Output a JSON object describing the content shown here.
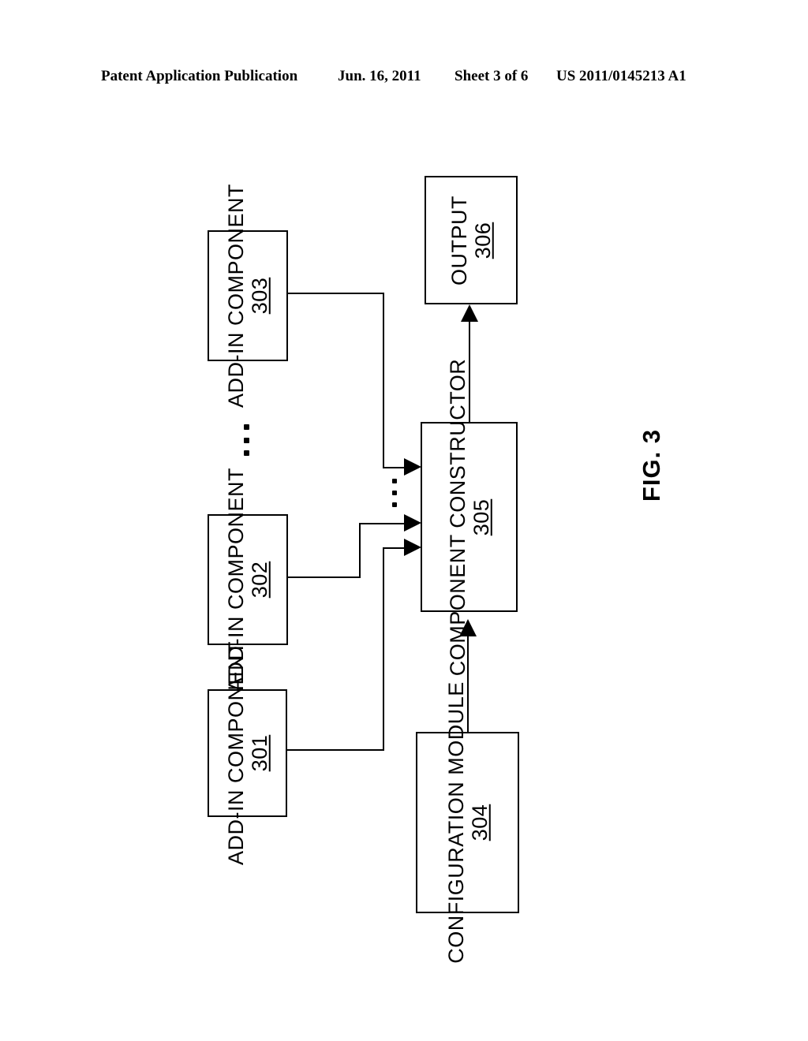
{
  "header": {
    "publication": "Patent Application Publication",
    "date": "Jun. 16, 2011",
    "sheet": "Sheet 3 of 6",
    "patent_number": "US 2011/0145213 A1"
  },
  "figure": {
    "label": "FIG. 3",
    "nodes": [
      {
        "id": "303",
        "name": "add-in-component-303",
        "line1": "ADD-IN",
        "line2": "COMPONENT",
        "ref": "303"
      },
      {
        "id": "302",
        "name": "add-in-component-302",
        "line1": "ADD-IN",
        "line2": "COMPONENT",
        "ref": "302"
      },
      {
        "id": "301",
        "name": "add-in-component-301",
        "line1": "ADD-IN",
        "line2": "COMPONENT",
        "ref": "301"
      },
      {
        "id": "306",
        "name": "output-306",
        "line1": "OUTPUT",
        "line2": "",
        "ref": "306"
      },
      {
        "id": "305",
        "name": "component-constructor-305",
        "line1": "COMPONENT",
        "line2": "CONSTRUCTOR",
        "ref": "305"
      },
      {
        "id": "304",
        "name": "configuration-module-304",
        "line1": "CONFIGURATION",
        "line2": "MODULE",
        "ref": "304"
      }
    ],
    "connections": [
      {
        "from": "303",
        "to": "305",
        "style": "orthogonal-arrow"
      },
      {
        "from": "302",
        "to": "305",
        "style": "orthogonal-arrow"
      },
      {
        "from": "301",
        "to": "305",
        "style": "orthogonal-arrow"
      },
      {
        "from": "305",
        "to": "306",
        "style": "vertical-arrow-up"
      },
      {
        "from": "304",
        "to": "305",
        "style": "vertical-arrow-up"
      }
    ],
    "ellipses": [
      {
        "name": "component-stack-ellipsis",
        "dots": 3
      },
      {
        "name": "input-arrows-ellipsis",
        "dots": 3
      }
    ],
    "colors": {
      "stroke": "#000000",
      "fill": "#ffffff"
    }
  }
}
